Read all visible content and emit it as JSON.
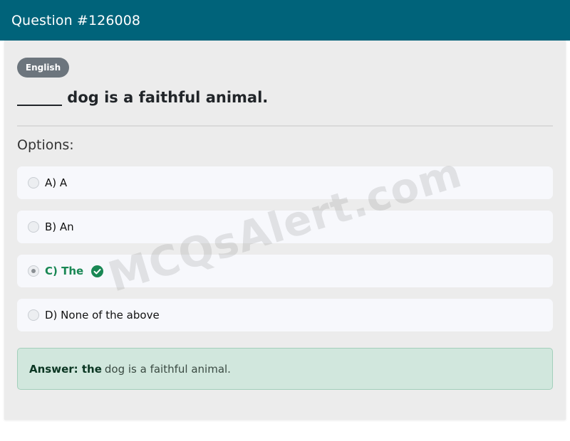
{
  "header": {
    "title": "Question #126008"
  },
  "badge": {
    "label": "English"
  },
  "question": {
    "text": "______ dog is a faithful animal."
  },
  "options_label": "Options:",
  "options": [
    {
      "text": "A) A",
      "selected": false,
      "correct": false
    },
    {
      "text": "B) An",
      "selected": false,
      "correct": false
    },
    {
      "text": "C) The",
      "selected": true,
      "correct": true,
      "icon": "check-circle-icon"
    },
    {
      "text": "D) None of the above",
      "selected": false,
      "correct": false
    }
  ],
  "answer": {
    "key": "Answer: the",
    "rest": "dog is a faithful animal."
  },
  "watermark": "MCQsAlert.com",
  "colors": {
    "header_bg": "#00637a",
    "correct_green": "#198754",
    "answer_bg": "#d1e7dd",
    "badge_bg": "#6c757d"
  }
}
